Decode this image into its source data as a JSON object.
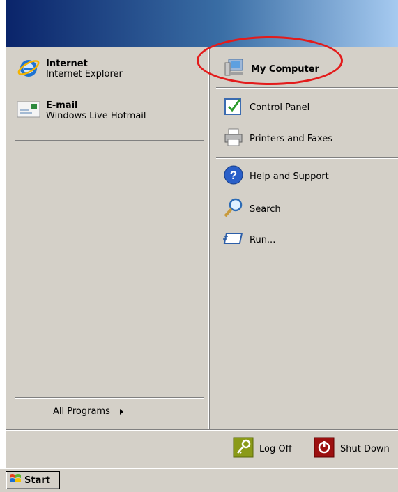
{
  "left_pane": {
    "pinned": [
      {
        "title": "Internet",
        "subtitle": "Internet Explorer",
        "icon": "internet-explorer-icon"
      },
      {
        "title": "E-mail",
        "subtitle": "Windows Live Hotmail",
        "icon": "email-icon"
      }
    ],
    "all_programs_label": "All Programs"
  },
  "right_pane": {
    "items": [
      {
        "label": "My Computer",
        "icon": "my-computer-icon"
      },
      {
        "label": "Control Panel",
        "icon": "control-panel-icon"
      },
      {
        "label": "Printers and Faxes",
        "icon": "printer-icon"
      },
      {
        "label": "Help and Support",
        "icon": "help-icon"
      },
      {
        "label": "Search",
        "icon": "search-icon"
      },
      {
        "label": "Run...",
        "icon": "run-icon"
      }
    ]
  },
  "bottom_bar": {
    "log_off_label": "Log Off",
    "shut_down_label": "Shut Down"
  },
  "taskbar": {
    "start_label": "Start"
  },
  "colors": {
    "annotation": "#e31b1b",
    "banner_dark": "#0a246a",
    "menu_face": "#d4d0c8"
  }
}
